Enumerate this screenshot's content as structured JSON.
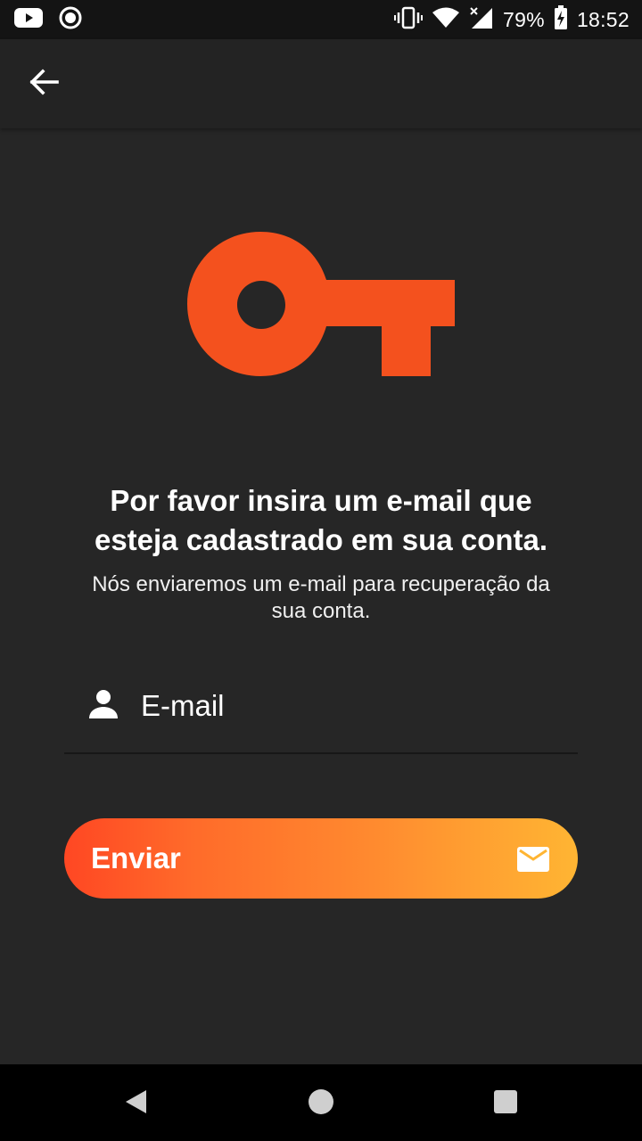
{
  "status_bar": {
    "battery": "79%",
    "time": "18:52",
    "icons": [
      "youtube-icon",
      "record-icon",
      "vibrate-icon",
      "wifi-icon",
      "signal-icon",
      "battery-charging-icon"
    ]
  },
  "app_bar": {
    "back_icon": "arrow-back-icon"
  },
  "hero": {
    "icon": "key-icon",
    "color": "#f4511e"
  },
  "content": {
    "title_line1": "Por favor insira um e-mail que",
    "title_line2": "esteja cadastrado em sua conta.",
    "subtitle_line1": "Nós enviaremos um e-mail para recuperação da",
    "subtitle_line2": "sua conta."
  },
  "form": {
    "email_icon": "person-icon",
    "email_placeholder": "E-mail",
    "email_value": ""
  },
  "send_button": {
    "label": "Enviar",
    "icon": "mail-icon",
    "gradient_start": "#ff4723",
    "gradient_end": "#ffb533"
  },
  "nav_bar": {
    "icons": [
      "back-triangle-icon",
      "home-circle-icon",
      "recents-square-icon"
    ]
  }
}
